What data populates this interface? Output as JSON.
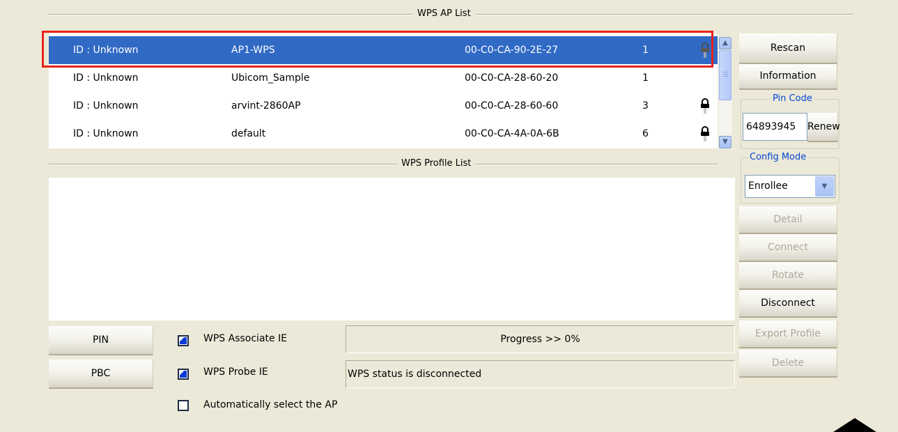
{
  "ap_list": {
    "title": "WPS AP List",
    "rows": [
      {
        "id": "ID : Unknown",
        "ssid": "AP1-WPS",
        "mac": "00-C0-CA-90-2E-27",
        "channel": "1",
        "locked": true,
        "selected": true
      },
      {
        "id": "ID : Unknown",
        "ssid": "Ubicom_Sample",
        "mac": "00-C0-CA-28-60-20",
        "channel": "1",
        "locked": false,
        "selected": false
      },
      {
        "id": "ID : Unknown",
        "ssid": "arvint-2860AP",
        "mac": "00-C0-CA-28-60-60",
        "channel": "3",
        "locked": true,
        "selected": false
      },
      {
        "id": "ID : Unknown",
        "ssid": "default",
        "mac": "00-C0-CA-4A-0A-6B",
        "channel": "6",
        "locked": true,
        "selected": false
      }
    ]
  },
  "profile_list": {
    "title": "WPS Profile List"
  },
  "buttons": {
    "rescan": "Rescan",
    "information": "Information",
    "renew": "Renew",
    "detail": "Detail",
    "connect": "Connect",
    "rotate": "Rotate",
    "disconnect": "Disconnect",
    "export_profile": "Export Profile",
    "delete": "Delete",
    "pin": "PIN",
    "pbc": "PBC"
  },
  "pin_code": {
    "label": "Pin Code",
    "value": "64893945"
  },
  "config_mode": {
    "label": "Config Mode",
    "selected": "Enrollee"
  },
  "options": {
    "wps_associate_ie": "WPS Associate IE",
    "wps_probe_ie": "WPS Probe IE",
    "auto_select_ap": "Automatically select the AP"
  },
  "checkbox_state": {
    "wps_associate_ie": true,
    "wps_probe_ie": true,
    "auto_select_ap": false
  },
  "status": {
    "progress": "Progress >> 0%",
    "message": "WPS status is disconnected"
  },
  "colors": {
    "selection": "#316ac5",
    "highlight_border": "#e8231c",
    "frame_title": "#0046d5",
    "background": "#ece9d8"
  },
  "icons": {
    "lock": "lock-icon",
    "scroll_up": "scroll-up-icon",
    "scroll_down": "scroll-down-icon",
    "dropdown": "chevron-down-icon"
  }
}
